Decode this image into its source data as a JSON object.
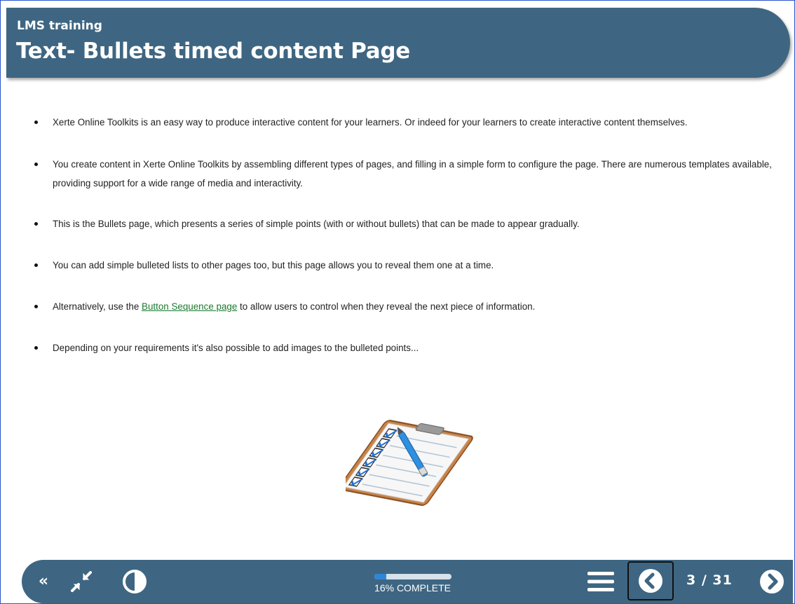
{
  "header": {
    "course_title": "LMS training",
    "page_title": "Text- Bullets timed content Page"
  },
  "content": {
    "bullets": [
      "Xerte Online Toolkits is an easy way to produce interactive content for your learners. Or indeed for your learners to create interactive content themselves.",
      "You create content in Xerte Online Toolkits by assembling different types of pages, and filling in a simple form to configure the page. There are numerous templates available, providing support for a wide range of media and interactivity.",
      "This is the Bullets page, which presents a series of simple points (with or without bullets) that can be made to appear gradually.",
      "You can add simple bulleted lists to other pages too, but this page allows you to reveal them one at a time.",
      {
        "before": "Alternatively, use the ",
        "link": "Button Sequence page",
        "after": " to allow users to control when they reveal the next piece of information."
      },
      "Depending on your requirements it's also possible to add images to the bulleted points..."
    ],
    "image_icon": "clipboard-checklist-icon"
  },
  "footer": {
    "icons": {
      "collapse": "double-chevron-left-icon",
      "exit_fullscreen": "compress-arrows-icon",
      "contrast": "contrast-icon",
      "menu": "hamburger-menu-icon",
      "prev": "chevron-left-circle-icon",
      "next": "chevron-right-circle-icon"
    },
    "progress_percent": 16,
    "progress_label": "16% COMPLETE",
    "page_counter": "3 / 31"
  },
  "colors": {
    "bar": "#3e6682",
    "link": "#1a7a2e",
    "progress": "#2f86d8"
  }
}
